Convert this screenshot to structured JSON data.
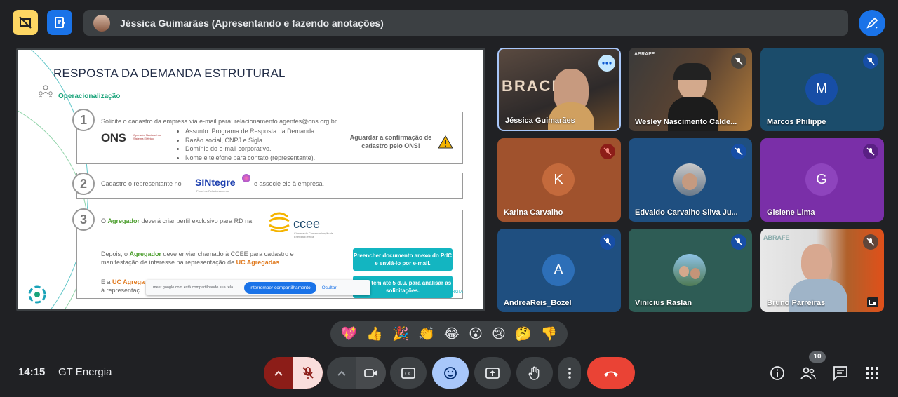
{
  "top_bar": {
    "presenter_text": "Jéssica Guimarães (Apresentando e fazendo anotações)",
    "left_icons": [
      "no-presentation-icon",
      "notes-icon"
    ],
    "right_icon": "annotate-pen-icon"
  },
  "slide": {
    "title": "RESPOSTA DA DEMANDA ESTRUTURAL",
    "subheading": "Operacionalização",
    "step1": {
      "num": "1",
      "text": "Solicite o cadastro da empresa via e-mail para: relacionamento.agentes@ons.org.br.",
      "logo": "ONS",
      "logo_sub": "Operador Nacional do Sistema Elétrico",
      "items": [
        "Assunto: Programa de Resposta da Demanda.",
        "Razão social, CNPJ e Sigla.",
        "Domínio do e-mail corporativo.",
        "Nome e telefone para contato (representante)."
      ],
      "note_line1": "Aguardar a confirmação de",
      "note_line2": "cadastro pelo ONS!"
    },
    "step2": {
      "num": "2",
      "text_before": "Cadastre o representante no",
      "logo": "SINtegre",
      "logo_sub": "Portal de Relacionamento",
      "text_after": "e associe ele à empresa."
    },
    "step3": {
      "num": "3",
      "line1_a": "O ",
      "line1_b": "Agregador",
      "line1_c": " deverá criar perfil exclusivo para RD na",
      "logo": "ccee",
      "logo_sub": "Câmara de Comercialização de Energia Elétrica",
      "p2_a": "Depois, o ",
      "p2_b": "Agregador",
      "p2_c": " deve enviar chamado à CCEE para cadastro e",
      "p2_d": "manifestação de interesse na representação de ",
      "p2_e": "UC Agregadas",
      "p2_f": ".",
      "p3_a": "E a ",
      "p3_b": "UC Agrega",
      "p3_c": "à representaç",
      "btn1": "Preencher documento anexo do PdC e enviá-lo por e-mail.",
      "btn2": "CCEE tem até 5 d.u. para analisar as solicitações."
    },
    "share_notice": "meet.google.com está compartilhando sua tela.",
    "stop_sharing": "Interromper compartilhamento",
    "hide": "Ocultar",
    "footer_mark": "RGIA"
  },
  "participants": [
    {
      "name": "Jéssica Guimarães",
      "type": "video",
      "status": "more-options"
    },
    {
      "name": "Wesley Nascimento Calde...",
      "type": "video",
      "status": "muted",
      "overlay": "ABRAFE"
    },
    {
      "name": "Marcos Philippe",
      "type": "avatar",
      "initial": "M",
      "status": "muted"
    },
    {
      "name": "Karina Carvalho",
      "type": "avatar",
      "initial": "K",
      "status": "muted-red"
    },
    {
      "name": "Edvaldo Carvalho Silva Ju...",
      "type": "photo",
      "status": "muted"
    },
    {
      "name": "Gislene Lima",
      "type": "avatar",
      "initial": "G",
      "status": "muted"
    },
    {
      "name": "AndreaReis_Bozel",
      "type": "avatar",
      "initial": "A",
      "status": "muted"
    },
    {
      "name": "Vinicius Raslan",
      "type": "photo",
      "status": "muted"
    },
    {
      "name": "Bruno Parreiras",
      "type": "video",
      "status": "muted",
      "overlay": "ABRAFE"
    }
  ],
  "reactions": [
    "💖",
    "👍",
    "🎉",
    "👏",
    "😂",
    "😮",
    "😢",
    "🤔",
    "👎"
  ],
  "bottom": {
    "time": "14:15",
    "meeting": "GT Energia",
    "people_count": "10",
    "controls": [
      "mic-options",
      "mic-off",
      "camera-options",
      "camera",
      "captions",
      "reactions",
      "present",
      "raise-hand",
      "more-options",
      "leave-call"
    ]
  },
  "colors": {
    "bg": "#202124",
    "accent_blue": "#1a73e8",
    "end_call": "#ea4335",
    "mic_off_red": "#f28b82"
  }
}
